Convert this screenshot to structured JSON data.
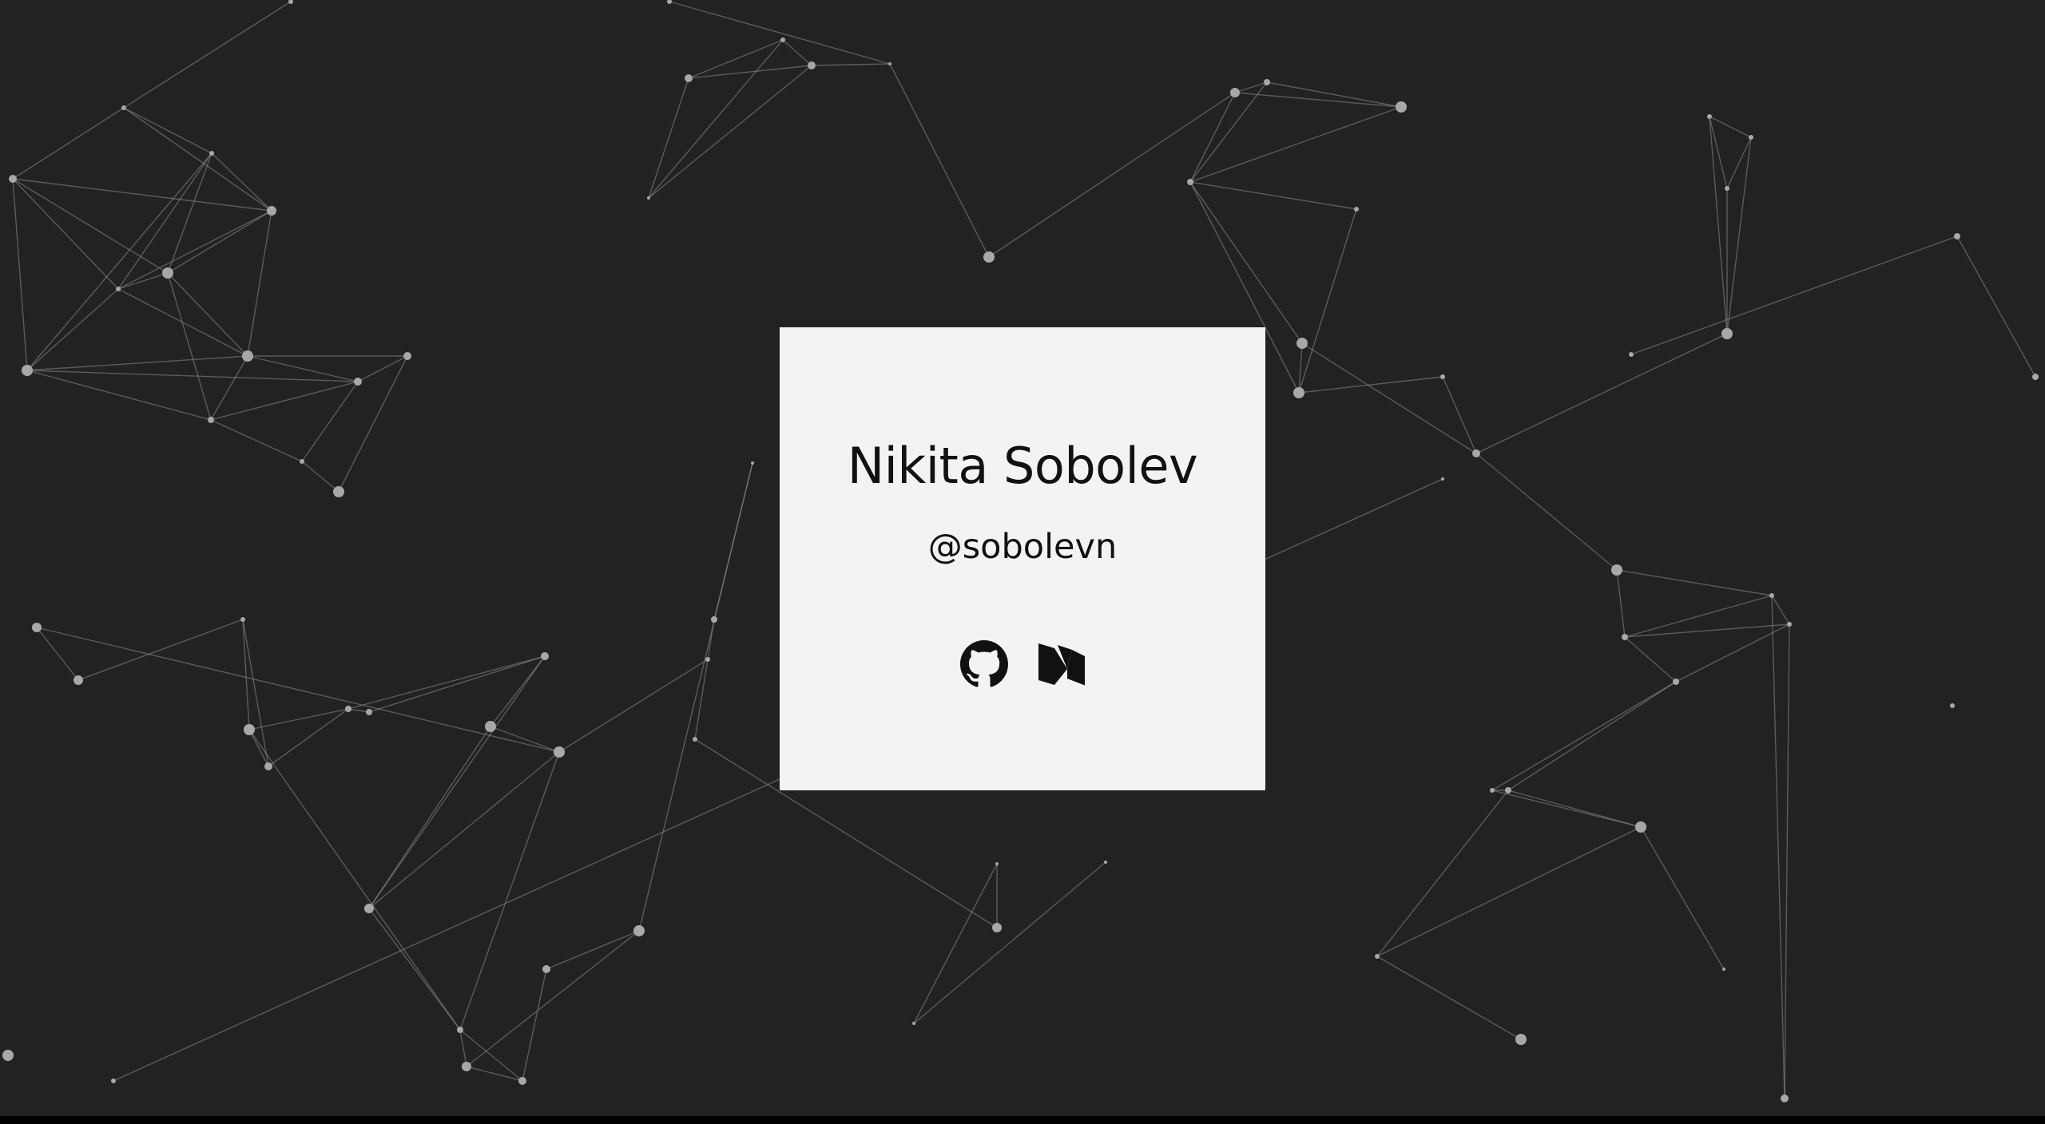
{
  "profile": {
    "name": "Nikita Sobolev",
    "handle": "@sobolevn"
  },
  "links": [
    {
      "icon": "github-icon",
      "service": "GitHub"
    },
    {
      "icon": "medium-icon",
      "service": "Medium"
    }
  ],
  "colors": {
    "background": "#222222",
    "card": "#f3f3f3",
    "text": "#111111",
    "network_lines": "#8a8a8a",
    "network_nodes": "#a8a8a8"
  }
}
